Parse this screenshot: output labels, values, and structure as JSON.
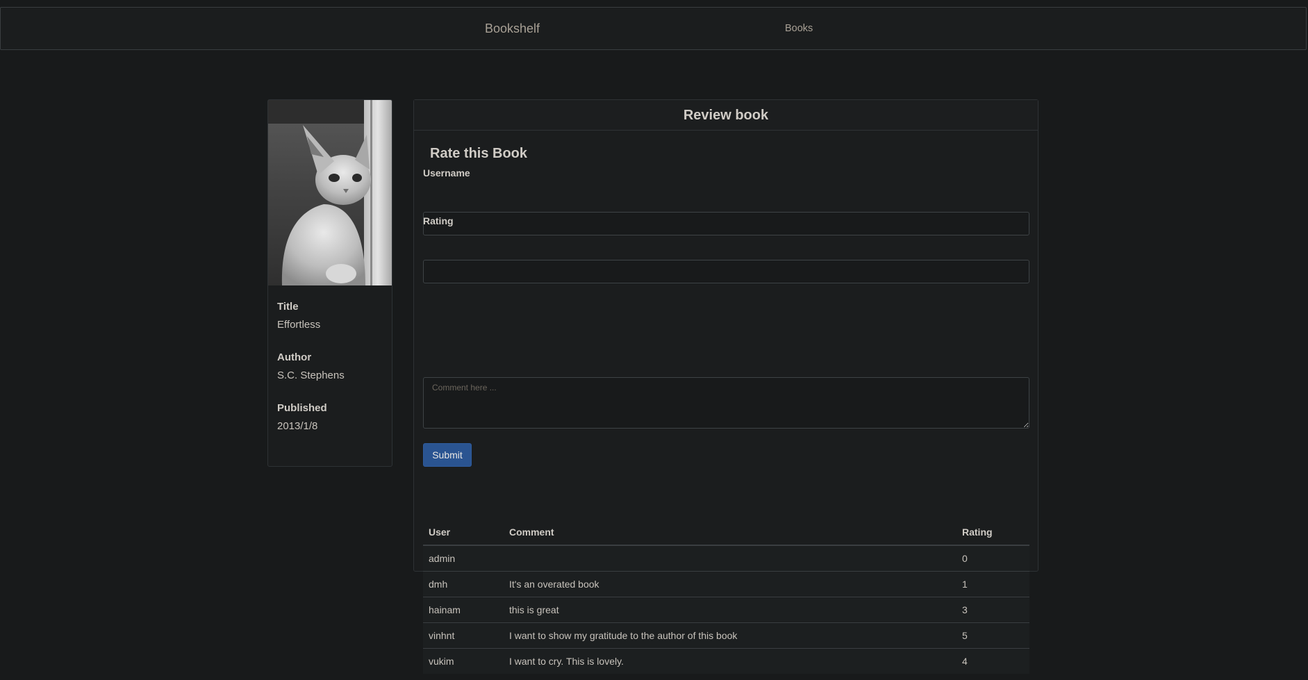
{
  "navbar": {
    "brand": "Bookshelf",
    "links": [
      {
        "label": "Books"
      }
    ]
  },
  "book": {
    "cover_icon": "cat-photo",
    "title_label": "Title",
    "title": "Effortless",
    "author_label": "Author",
    "author": "S.C. Stephens",
    "published_label": "Published",
    "published": "2013/1/8"
  },
  "review": {
    "header": "Review book",
    "form_title": "Rate this Book",
    "username_label": "Username",
    "username_value": "",
    "rating_label": "Rating",
    "rating_value": "",
    "comment_placeholder": "Comment here ...",
    "submit_label": "Submit"
  },
  "table": {
    "headers": [
      "User",
      "Comment",
      "Rating"
    ],
    "rows": [
      {
        "user": "admin",
        "comment": "",
        "rating": "0"
      },
      {
        "user": "dmh",
        "comment": "It's an overated book",
        "rating": "1"
      },
      {
        "user": "hainam",
        "comment": "this is great",
        "rating": "3"
      },
      {
        "user": "vinhnt",
        "comment": "I want to show my gratitude to the author of this book",
        "rating": "5"
      },
      {
        "user": "vukim",
        "comment": "I want to cry. This is lovely.",
        "rating": "4"
      }
    ]
  },
  "colors": {
    "background": "#181a1b",
    "panel": "#1b1d1e",
    "primary_button": "#2a5491",
    "text": "#d0ccc6"
  }
}
